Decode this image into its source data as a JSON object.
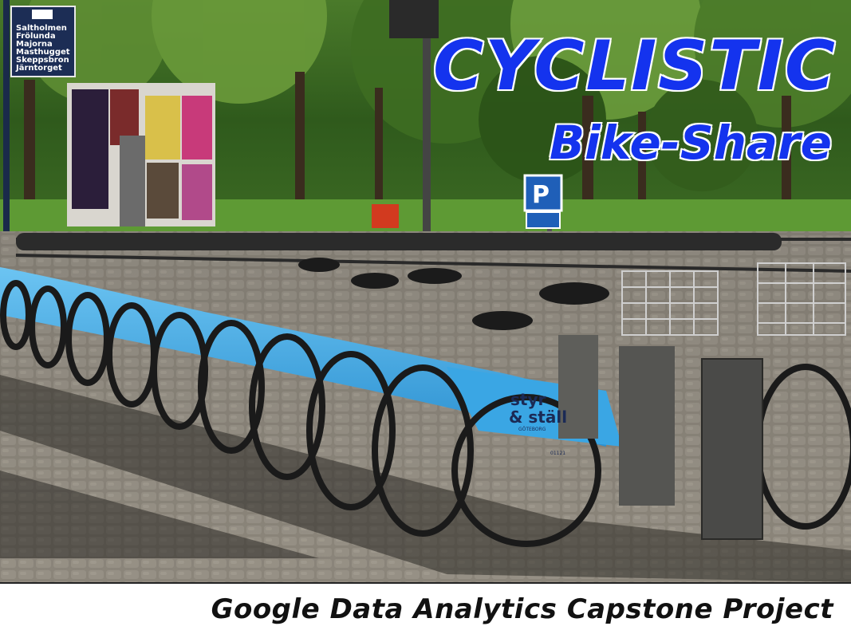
{
  "title": {
    "main": "CYCLISTIC",
    "sub": "Bike-Share"
  },
  "caption": "Google Data Analytics Capstone Project",
  "street_sign": {
    "lines": [
      "Saltholmen",
      "Frölunda",
      "Majorna",
      "Masthugget",
      "Skeppsbron",
      "Järntorget"
    ]
  },
  "bike_brand": {
    "line1": "styr",
    "line2": "& ställ",
    "city": "GÖTEBORG",
    "serial": "01121"
  },
  "parking_sign": "P",
  "colors": {
    "title_blue": "#1433ee",
    "bike_blue": "#3aa6e4",
    "sign_navy": "#1c2d55"
  }
}
